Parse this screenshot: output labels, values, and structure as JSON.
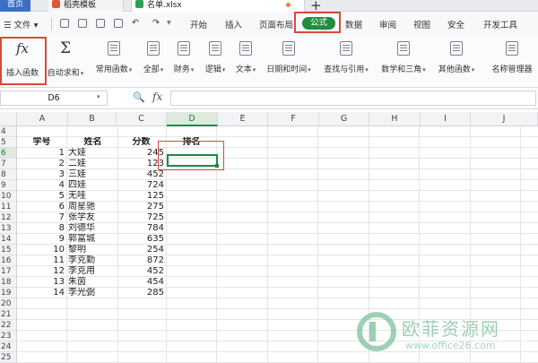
{
  "tabs": {
    "home": "首页",
    "template": "稻壳模板",
    "file": "名单.xlsx",
    "new_tab": "+"
  },
  "menu": {
    "file_menu": "文件",
    "items": [
      "开始",
      "插入",
      "页面布局",
      "公式",
      "数据",
      "审阅",
      "视图",
      "安全",
      "开发工具"
    ],
    "active": "公式"
  },
  "ribbon": {
    "insert_function": "插入函数",
    "autosum": "自动求和",
    "common_functions": "常用函数",
    "all": "全部",
    "financial": "财务",
    "logical": "逻辑",
    "text": "文本",
    "date_time": "日期和时间",
    "lookup": "查找与引用",
    "math_trig": "数学和三角",
    "other": "其他函数",
    "name_manager": "名称管理器",
    "fx_glyph": "fx",
    "sigma_glyph": "Σ"
  },
  "formula_bar": {
    "name_box": "D6",
    "fx": "fx",
    "zoom_glyph": "🔍",
    "value": ""
  },
  "sheet": {
    "columns": [
      "A",
      "B",
      "C",
      "D",
      "E",
      "F",
      "G",
      "H",
      "I",
      "J"
    ],
    "active_column": "D",
    "active_row": 6,
    "rows": [
      {
        "n": 4
      },
      {
        "n": 5,
        "a": "学号",
        "b": "姓名",
        "c": "分数",
        "d": "排名",
        "header": true
      },
      {
        "n": 6,
        "a": "1",
        "b": "大娃",
        "c": "245"
      },
      {
        "n": 7,
        "a": "2",
        "b": "二娃",
        "c": "123"
      },
      {
        "n": 8,
        "a": "3",
        "b": "三娃",
        "c": "452"
      },
      {
        "n": 9,
        "a": "4",
        "b": "四娃",
        "c": "724"
      },
      {
        "n": 10,
        "a": "5",
        "b": "无哇",
        "c": "125"
      },
      {
        "n": 11,
        "a": "6",
        "b": "周星驰",
        "c": "275"
      },
      {
        "n": 12,
        "a": "7",
        "b": "张学友",
        "c": "725"
      },
      {
        "n": 13,
        "a": "8",
        "b": "刘德华",
        "c": "784"
      },
      {
        "n": 14,
        "a": "9",
        "b": "郭富城",
        "c": "635"
      },
      {
        "n": 15,
        "a": "10",
        "b": "黎明",
        "c": "254"
      },
      {
        "n": 16,
        "a": "11",
        "b": "李克勤",
        "c": "872"
      },
      {
        "n": 17,
        "a": "12",
        "b": "李克用",
        "c": "452"
      },
      {
        "n": 18,
        "a": "13",
        "b": "朱茵",
        "c": "454"
      },
      {
        "n": 19,
        "a": "14",
        "b": "李光弼",
        "c": "285"
      },
      {
        "n": 20
      },
      {
        "n": 21
      },
      {
        "n": 22
      },
      {
        "n": 23
      },
      {
        "n": 24
      },
      {
        "n": 25
      }
    ]
  },
  "watermark": {
    "name": "欧菲资源网",
    "url": "www.office26.com"
  },
  "colors": {
    "accent_green": "#1e8e3e",
    "highlight_red": "#d94a3d"
  }
}
